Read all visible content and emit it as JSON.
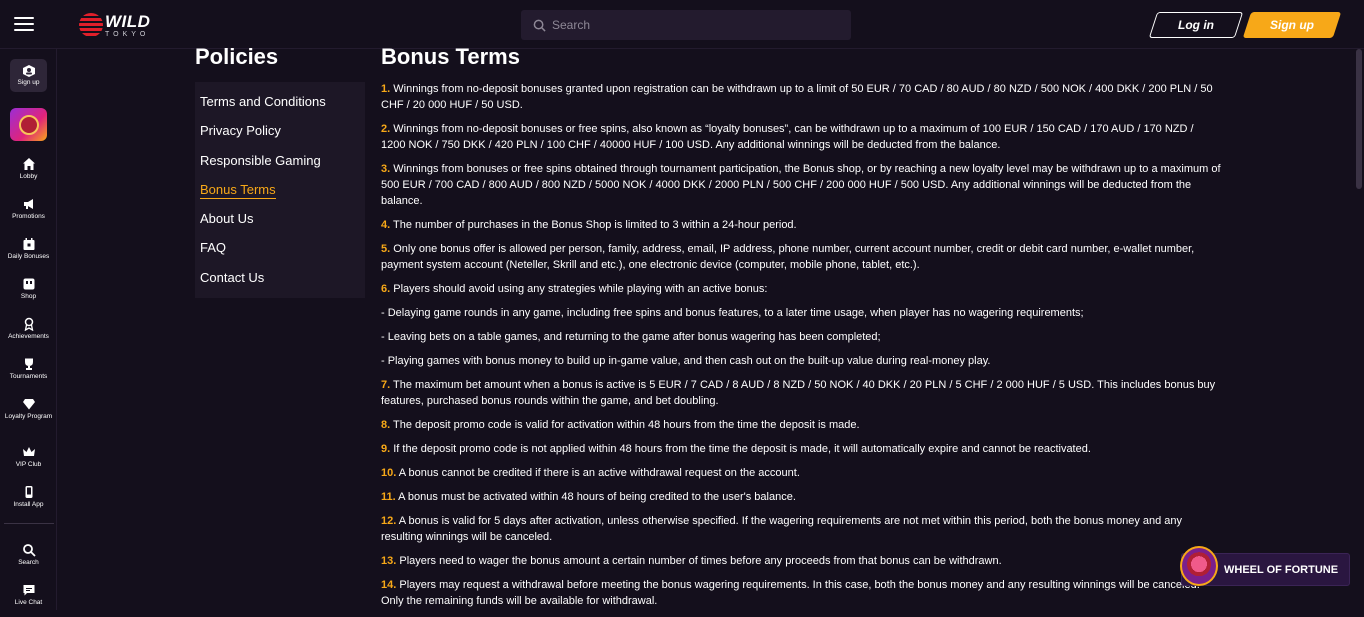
{
  "header": {
    "logo_main": "WILD",
    "logo_sub": "TOKYO",
    "search_placeholder": "Search",
    "login_label": "Log in",
    "signup_label": "Sign up"
  },
  "sidebar": {
    "signup_label": "Sign up",
    "items": [
      {
        "label": "Lobby",
        "icon": "home-icon"
      },
      {
        "label": "Promotions",
        "icon": "megaphone-icon"
      },
      {
        "label": "Daily Bonuses",
        "icon": "calendar-icon"
      },
      {
        "label": "Shop",
        "icon": "shop-icon"
      },
      {
        "label": "Achievements",
        "icon": "medal-icon"
      },
      {
        "label": "Tournaments",
        "icon": "trophy-icon"
      },
      {
        "label": "Loyalty Program",
        "icon": "diamond-icon"
      },
      {
        "label": "VIP Club",
        "icon": "crown-icon"
      },
      {
        "label": "Install App",
        "icon": "phone-icon"
      },
      {
        "label": "Search",
        "icon": "search-icon"
      },
      {
        "label": "Live Chat",
        "icon": "chat-icon"
      }
    ]
  },
  "policies": {
    "title": "Policies",
    "items": [
      "Terms and Conditions",
      "Privacy Policy",
      "Responsible Gaming",
      "Bonus Terms",
      "About Us",
      "FAQ",
      "Contact Us"
    ],
    "active": "Bonus Terms"
  },
  "content": {
    "title": "Bonus Terms",
    "terms": [
      {
        "num": "1.",
        "text": "Winnings from no-deposit bonuses granted upon registration can be withdrawn up to a limit of 50 EUR / 70 CAD / 80 AUD / 80 NZD / 500 NOK / 400 DKK / 200 PLN / 50 CHF / 20 000 HUF / 50 USD."
      },
      {
        "num": "2.",
        "text": "Winnings from no-deposit bonuses or free spins, also known as “loyalty bonuses”, can be withdrawn up to a maximum of 100 EUR / 150 CAD / 170 AUD / 170 NZD / 1200 NOK / 750 DKK / 420 PLN / 100 CHF / 40000 HUF / 100 USD. Any additional winnings will be deducted from the balance."
      },
      {
        "num": "3.",
        "text": "Winnings from bonuses or free spins obtained through tournament participation, the Bonus shop, or by reaching a new loyalty level may be withdrawn up to a maximum of 500 EUR / 700 CAD / 800 AUD / 800 NZD / 5000 NOK / 4000 DKK / 2000 PLN / 500 CHF / 200 000 HUF / 500 USD. Any additional winnings will be deducted from the balance."
      },
      {
        "num": "4.",
        "text": "The number of purchases in the Bonus Shop is limited to 3 within a 24-hour period."
      },
      {
        "num": "5.",
        "text": "Only one bonus offer is allowed per person, family, address, email, IP address, phone number, current account number, credit or debit card number, e-wallet number, payment system account (Neteller, Skrill and etc.), one electronic device (computer, mobile phone, tablet, etc.)."
      },
      {
        "num": "6.",
        "text": "Players should avoid using any strategies while playing with an active bonus:"
      },
      {
        "num": "",
        "text": "- Delaying game rounds in any game, including free spins and bonus features, to a later time usage, when player has no wagering requirements;"
      },
      {
        "num": "",
        "text": "- Leaving bets on a table games, and returning to the game after bonus wagering has been completed;"
      },
      {
        "num": "",
        "text": "- Playing games with bonus money to build up in-game value, and then cash out on the built-up value during real-money play."
      },
      {
        "num": "7.",
        "text": "The maximum bet amount when a bonus is active is 5 EUR / 7 CAD / 8 AUD / 8 NZD / 50 NOK / 40 DKK / 20 PLN / 5 CHF / 2 000 HUF / 5 USD. This includes bonus buy features, purchased bonus rounds within the game, and bet doubling."
      },
      {
        "num": "8.",
        "text": "The deposit promo code is valid for activation within 48 hours from the time the deposit is made."
      },
      {
        "num": "9.",
        "text": "If the deposit promo code is not applied within 48 hours from the time the deposit is made, it will automatically expire and cannot be reactivated."
      },
      {
        "num": "10.",
        "text": "A bonus cannot be credited if there is an active withdrawal request on the account."
      },
      {
        "num": "11.",
        "text": "A bonus must be activated within 48 hours of being credited to the user's balance."
      },
      {
        "num": "12.",
        "text": "A bonus is valid for 5 days after activation, unless otherwise specified. If the wagering requirements are not met within this period, both the bonus money and any resulting winnings will be canceled."
      },
      {
        "num": "13.",
        "text": "Players need to wager the bonus amount a certain number of times before any proceeds from that bonus can be withdrawn."
      },
      {
        "num": "14.",
        "text": "Players may request a withdrawal before meeting the bonus wagering requirements. In this case, both the bonus money and any resulting winnings will be canceled. Only the remaining funds will be available for withdrawal."
      }
    ]
  },
  "wheel": {
    "label": "WHEEL OF FORTUNE"
  },
  "colors": {
    "accent": "#f7a818",
    "background": "#140f1c",
    "panel": "#1d1726"
  }
}
